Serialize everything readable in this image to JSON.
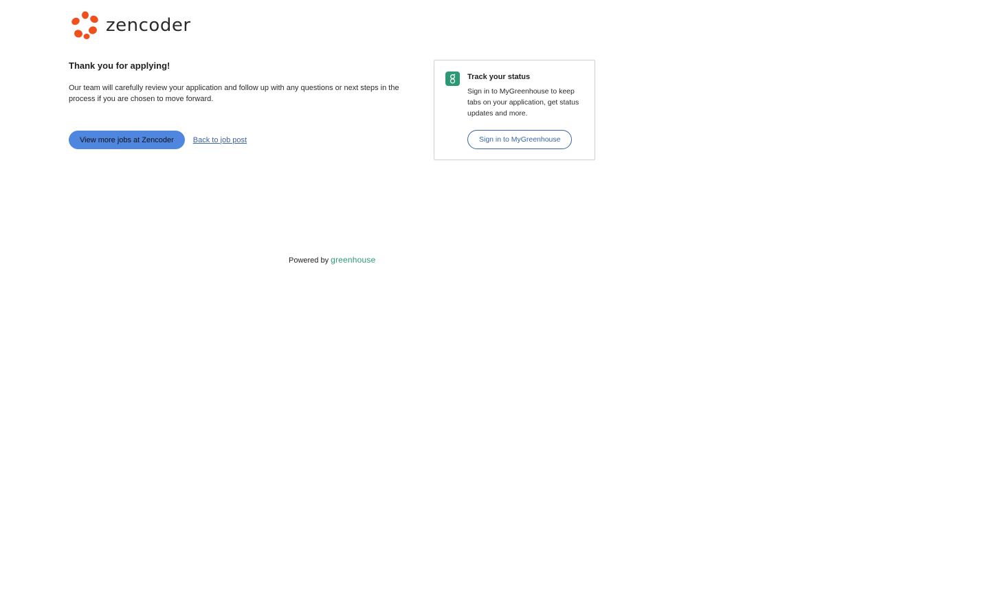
{
  "brand": {
    "name": "zencoder",
    "accent_color": "#f0501e"
  },
  "confirmation": {
    "title": "Thank you for applying!",
    "message": "Our team will carefully review your application and follow up with any questions or next steps in the process if you are chosen to move forward.",
    "view_jobs_label": "View more jobs at Zencoder",
    "back_label": "Back to job post"
  },
  "status_card": {
    "icon": "greenhouse-g-icon",
    "title": "Track your status",
    "body": "Sign in to MyGreenhouse to keep tabs on your application, get status updates and more.",
    "signin_label": "Sign in to MyGreenhouse",
    "badge_color": "#2b9a73"
  },
  "footer": {
    "powered_by": "Powered by",
    "provider": "greenhouse"
  }
}
